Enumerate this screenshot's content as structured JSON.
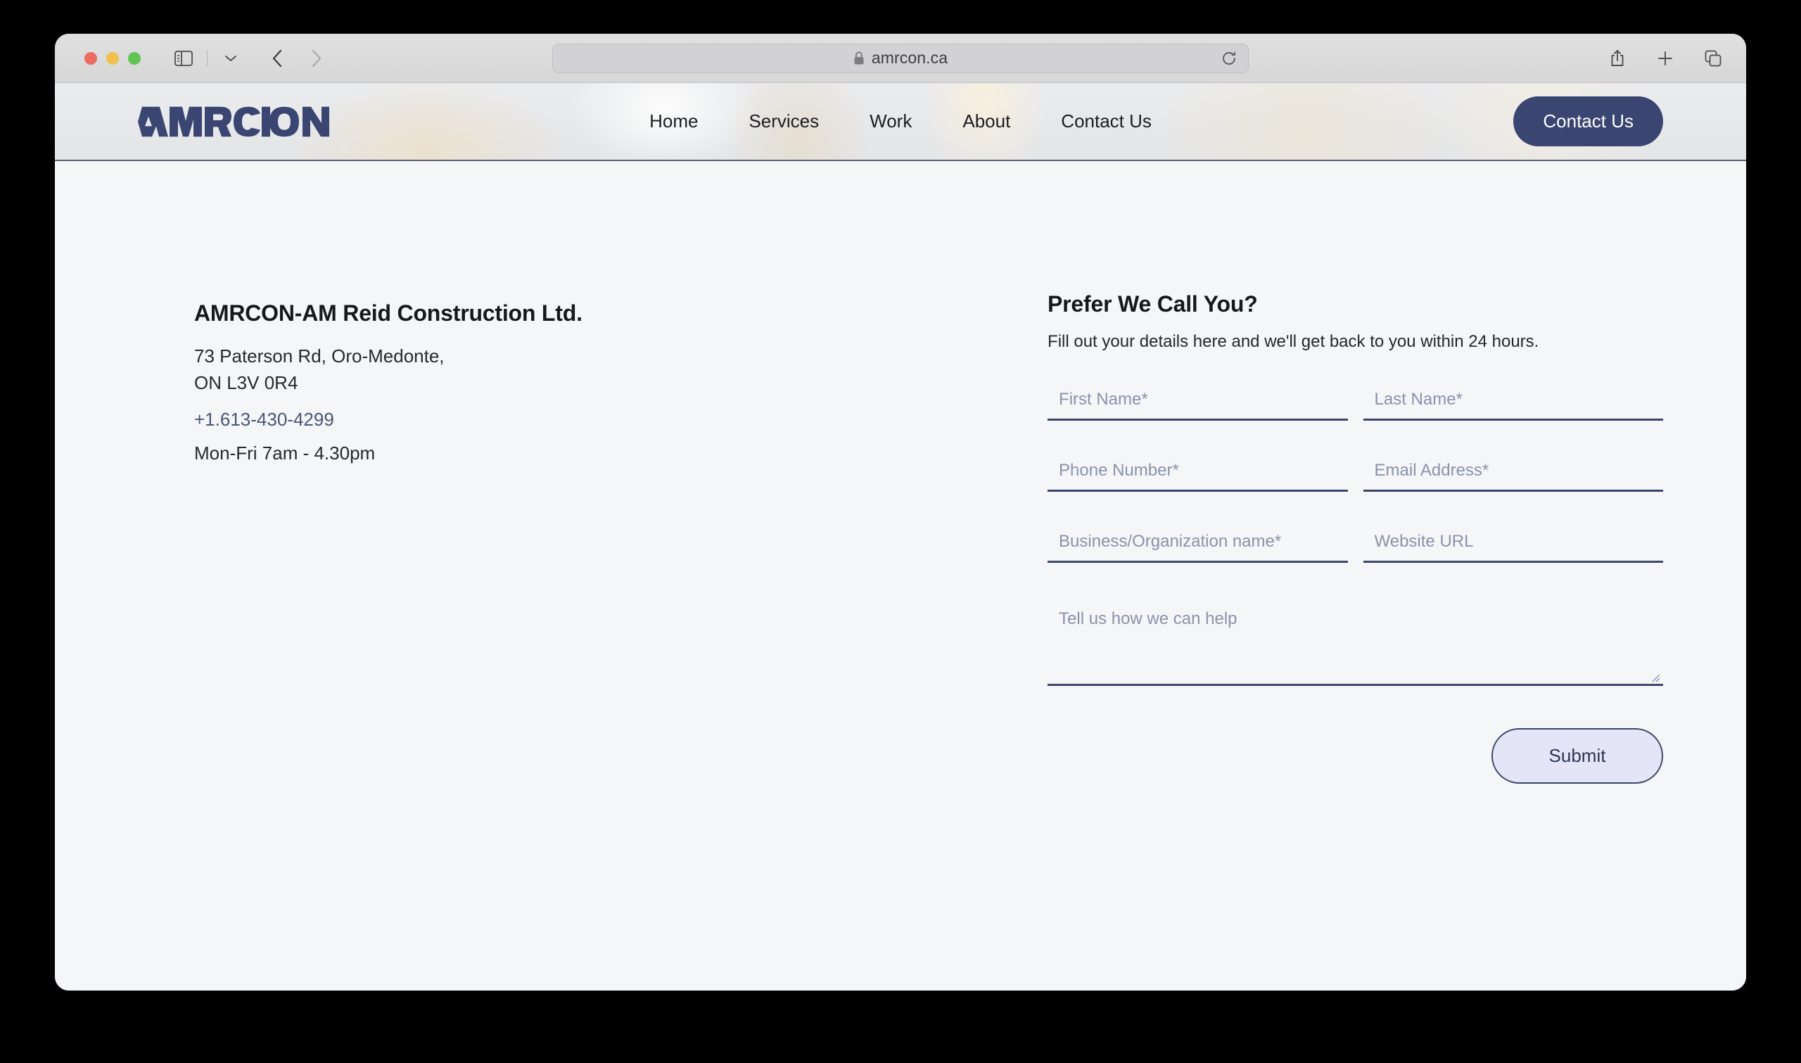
{
  "browser": {
    "traffic_lights": [
      "close",
      "minimize",
      "maximize"
    ],
    "url": "amrcon.ca",
    "sidebar_icon": "sidebar-icon",
    "dropdown_icon": "chevron-down-icon",
    "back_icon": "chevron-left-icon",
    "forward_icon": "chevron-right-icon",
    "lock_icon": "lock-icon",
    "reload_icon": "reload-icon",
    "share_icon": "share-icon",
    "new_tab_icon": "plus-icon",
    "tab_overview_icon": "tab-overview-icon"
  },
  "site": {
    "logo_text": "AMRCON",
    "nav": [
      {
        "label": "Home"
      },
      {
        "label": "Services"
      },
      {
        "label": "Work"
      },
      {
        "label": "About"
      },
      {
        "label": "Contact Us"
      }
    ],
    "cta_label": "Contact Us",
    "accent_color": "#3b4571"
  },
  "contact": {
    "company": "AMRCON-AM Reid Construction Ltd.",
    "address_line1": "73 Paterson Rd, Oro-Medonte,",
    "address_line2": "ON L3V 0R4",
    "phone": "+1.613-430-4299",
    "hours": "Mon-Fri 7am - 4.30pm"
  },
  "form": {
    "title": "Prefer We Call You?",
    "subtitle": "Fill out your details here and we'll get back to you within 24 hours.",
    "fields": {
      "first_name": {
        "placeholder": "First Name*",
        "value": ""
      },
      "last_name": {
        "placeholder": "Last Name*",
        "value": ""
      },
      "phone": {
        "placeholder": "Phone Number*",
        "value": ""
      },
      "email": {
        "placeholder": "Email Address*",
        "value": ""
      },
      "business": {
        "placeholder": "Business/Organization name*",
        "value": ""
      },
      "website": {
        "placeholder": "Website URL",
        "value": ""
      },
      "message": {
        "placeholder": "Tell us how we can help",
        "value": ""
      }
    },
    "submit_label": "Submit"
  }
}
